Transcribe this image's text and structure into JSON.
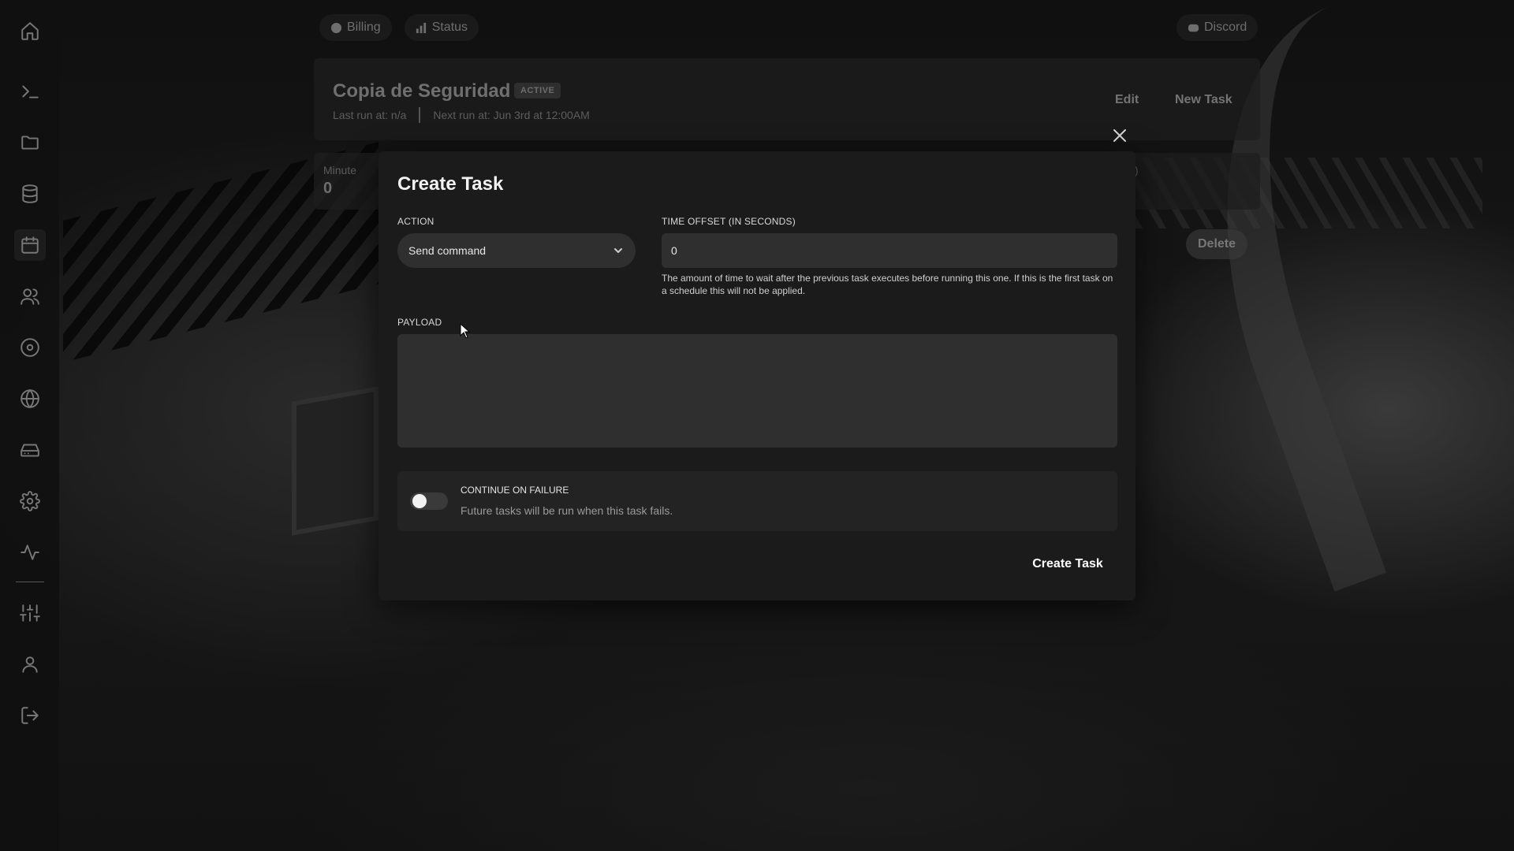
{
  "topnav": {
    "billing": "Billing",
    "status": "Status",
    "discord": "Discord"
  },
  "sidebar": {
    "items": [
      {
        "icon": "home-icon"
      },
      {
        "icon": "terminal-icon"
      },
      {
        "icon": "folder-icon"
      },
      {
        "icon": "database-icon"
      },
      {
        "icon": "calendar-icon",
        "active": true
      },
      {
        "icon": "users-icon"
      },
      {
        "icon": "disc-icon"
      },
      {
        "icon": "globe-icon"
      },
      {
        "icon": "hard-drive-icon"
      },
      {
        "icon": "gear-icon"
      },
      {
        "icon": "activity-icon"
      },
      {
        "icon": "sliders-icon"
      },
      {
        "icon": "user-icon"
      },
      {
        "icon": "logout-icon"
      }
    ]
  },
  "schedule": {
    "title": "Copia de Seguridad",
    "badge": "ACTIVE",
    "last_run": "Last run at: n/a",
    "next_run": "Next run at: Jun 3rd at 12:00AM",
    "edit": "Edit",
    "new_task": "New Task",
    "minute_label": "Minute",
    "minute_value": "0",
    "right_label": "k)",
    "delete": "Delete"
  },
  "modal": {
    "title": "Create Task",
    "action_label": "Action",
    "action_value": "Send command",
    "offset_label": "Time offset (in seconds)",
    "offset_value": "0",
    "offset_help": "The amount of time to wait after the previous task executes before running this one. If this is the first task on a schedule this will not be applied.",
    "payload_label": "Payload",
    "payload_value": "",
    "failure_title": "Continue on failure",
    "failure_desc": "Future tasks will be run when this task fails.",
    "failure_enabled": false,
    "submit": "Create Task"
  }
}
